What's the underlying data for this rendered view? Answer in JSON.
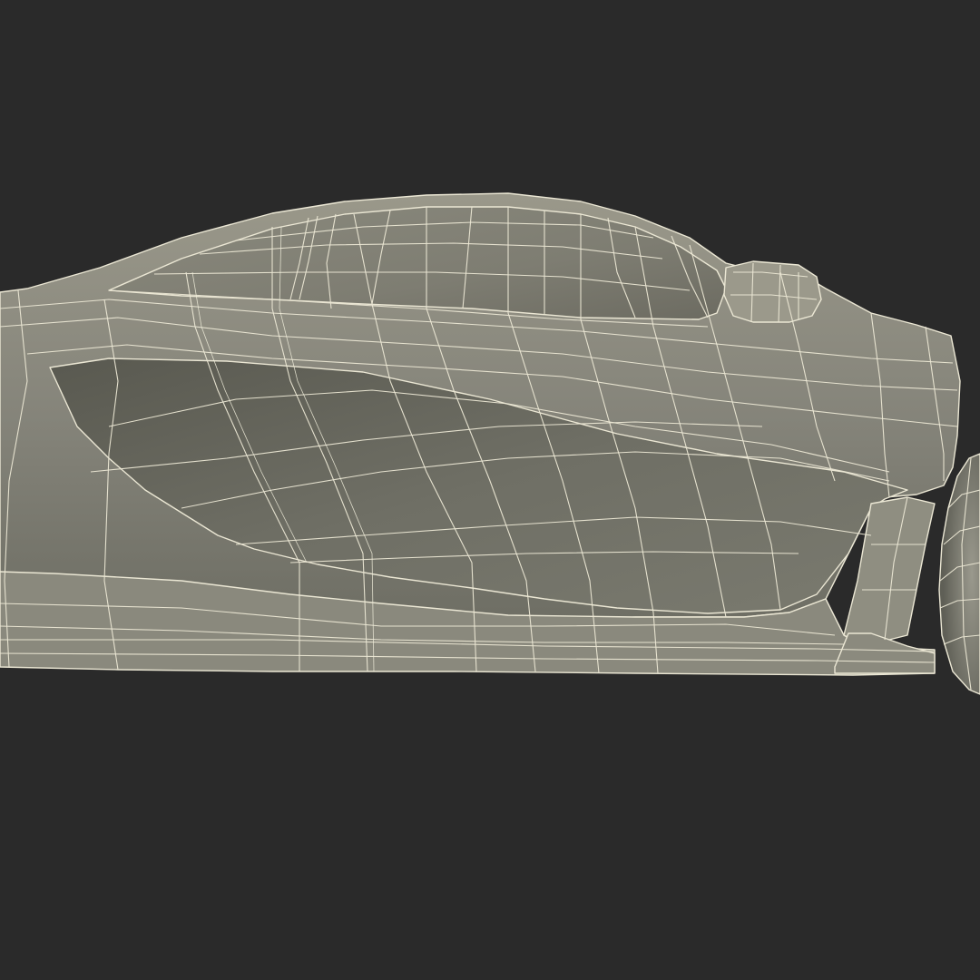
{
  "scene": {
    "subject": "sports-car-wireframe-side-view",
    "colors": {
      "background": "#2a2a2a",
      "panel_light": "#8e8c7f",
      "panel_mid": "#7c7b6f",
      "panel_dark": "#5d5d53",
      "cavity": "#6f6f64",
      "wire": "#ebe7d4"
    }
  }
}
